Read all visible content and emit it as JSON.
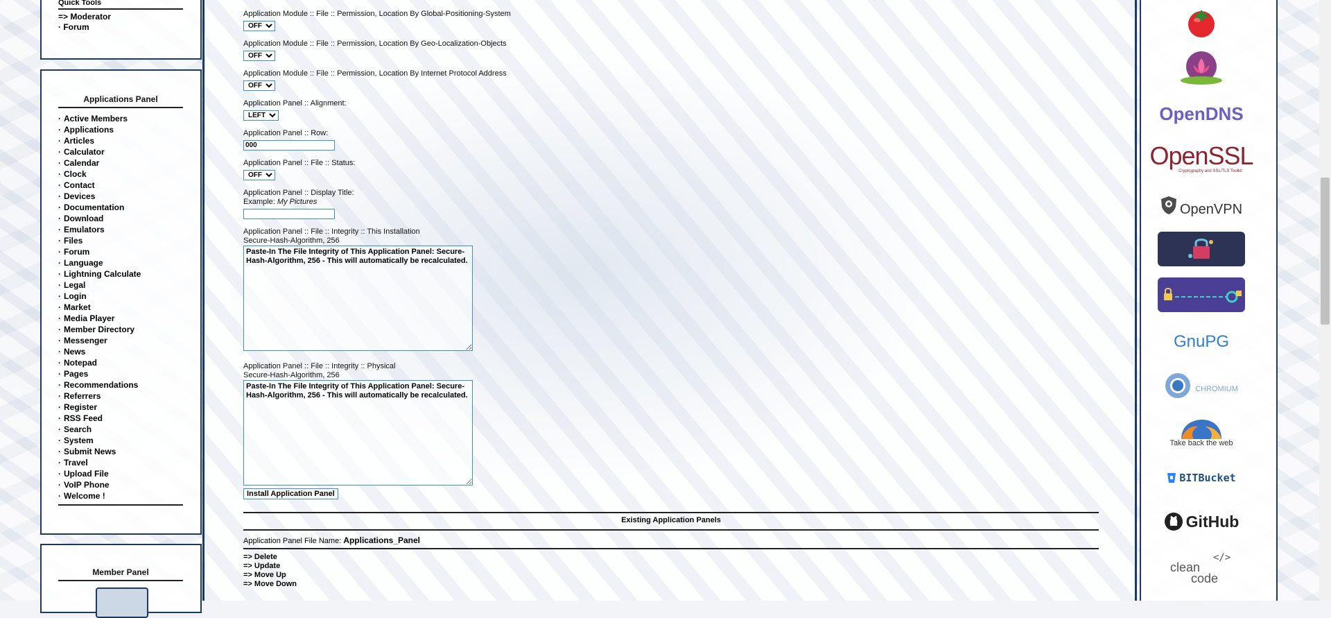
{
  "quick_tools": {
    "title": "Quick Tools",
    "items": [
      "=> Moderator",
      "· Forum"
    ]
  },
  "applications_panel": {
    "title": "Applications Panel",
    "items": [
      "Active Members",
      "Applications",
      "Articles",
      "Calculator",
      "Calendar",
      "Clock",
      "Contact",
      "Devices",
      "Documentation",
      "Download",
      "Emulators",
      "Files",
      "Forum",
      "Language",
      "Lightning Calculate",
      "Legal",
      "Login",
      "Market",
      "Media Player",
      "Member Directory",
      "Messenger",
      "News",
      "Notepad",
      "Pages",
      "Recommendations",
      "Referrers",
      "Register",
      "RSS Feed",
      "Search",
      "System",
      "Submit News",
      "Travel",
      "Upload File",
      "VoIP Phone",
      "Welcome !"
    ]
  },
  "member_panel": {
    "title": "Member Panel"
  },
  "form": {
    "gps_label": "Application Module :: File :: Permission, Location By Global-Positioning-System",
    "gps_value": "OFF",
    "geo_label": "Application Module :: File :: Permission, Location By Geo-Localization-Objects",
    "geo_value": "OFF",
    "ip_label": "Application Module :: File :: Permission, Location By Internet Protocol Address",
    "ip_value": "OFF",
    "align_label": "Application Panel :: Alignment:",
    "align_value": "LEFT",
    "row_label": "Application Panel :: Row:",
    "row_value": "000",
    "status_label": "Application Panel :: File :: Status:",
    "status_value": "OFF",
    "display_title_label": "Application Panel :: Display Title:",
    "display_title_example_prefix": "Example:",
    "display_title_example": "My Pictures",
    "display_title_value": "",
    "integrity_install_label": "Application Panel :: File :: Integrity :: This Installation",
    "integrity_install_sub": "Secure-Hash-Algorithm, 256",
    "integrity_install_text": "Paste-In The File Integrity of This Application Panel: Secure-Hash-Algorithm, 256 - This will automatically be recalculated.",
    "integrity_physical_label": "Application Panel :: File :: Integrity :: Physical",
    "integrity_physical_sub": "Secure-Hash-Algorithm, 256",
    "integrity_physical_text": "Paste-In The File Integrity of This Application Panel: Secure-Hash-Algorithm, 256 - This will automatically be recalculated.",
    "install_button": "Install Application Panel"
  },
  "existing": {
    "title": "Existing Application Panels",
    "file_name_label": "Application Panel File Name:",
    "file_name_value": "Applications_Panel",
    "actions": [
      "=> Delete",
      "=> Update",
      "=> Move Up",
      "=> Move Down"
    ]
  },
  "logos": {
    "opendns": "OpenDNS",
    "openssl": "OpenSSL",
    "openssl_sub": "Cryptography and SSL/TLS Toolkit",
    "openvpn": "OpenVPN",
    "gnupg": "GnuPG",
    "chromium": "CHROMIUM",
    "firefox_caption": "Take back the web",
    "bitbucket": "BITBucket",
    "github": "GitHub",
    "cleancode_1": "clean",
    "cleancode_2": "code",
    "cleancode_tag": "</>"
  },
  "colors": {
    "frame": "#1c3a5e",
    "input_border": "#3b8fd6",
    "opendns": "#6b5fc4",
    "openssl": "#8a2430"
  }
}
